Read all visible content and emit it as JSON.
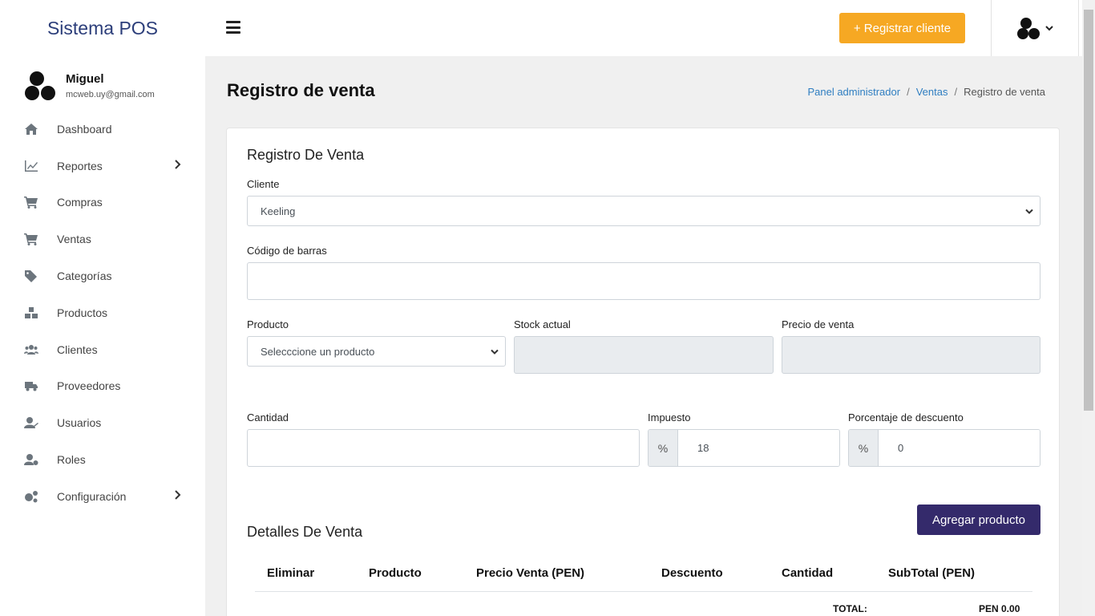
{
  "app": {
    "brand": "Sistema POS"
  },
  "user": {
    "name": "Miguel",
    "email": "mcweb.uy@gmail.com"
  },
  "sidebar": {
    "items": [
      {
        "label": "Dashboard",
        "icon": "home-icon"
      },
      {
        "label": "Reportes",
        "icon": "chart-line-icon",
        "has_submenu": true
      },
      {
        "label": "Compras",
        "icon": "cart-plus-icon"
      },
      {
        "label": "Ventas",
        "icon": "shopping-cart-icon"
      },
      {
        "label": "Categorías",
        "icon": "tags-icon"
      },
      {
        "label": "Productos",
        "icon": "boxes-icon"
      },
      {
        "label": "Clientes",
        "icon": "users-icon"
      },
      {
        "label": "Proveedores",
        "icon": "truck-icon"
      },
      {
        "label": "Usuarios",
        "icon": "user-edit-icon"
      },
      {
        "label": "Roles",
        "icon": "user-cog-icon"
      },
      {
        "label": "Configuración",
        "icon": "cogs-icon",
        "has_submenu": true
      }
    ]
  },
  "topbar": {
    "register_client_label": "+ Registrar cliente"
  },
  "page": {
    "title": "Registro de venta",
    "breadcrumb": [
      "Panel administrador",
      "Ventas",
      "Registro de venta"
    ]
  },
  "form": {
    "card_title": "Registro De Venta",
    "client_label": "Cliente",
    "client_value": "Keeling",
    "barcode_label": "Código de barras",
    "barcode_value": "",
    "product_label": "Producto",
    "product_value": "Selecccione un producto",
    "stock_label": "Stock actual",
    "price_label": "Precio de venta",
    "quantity_label": "Cantidad",
    "tax_label": "Impuesto",
    "tax_addon": "%",
    "tax_value": "18",
    "discount_label": "Porcentaje de descuento",
    "discount_addon": "%",
    "discount_value": "0",
    "add_product_label": "Agregar producto"
  },
  "details": {
    "title": "Detalles De Venta",
    "columns": [
      "Eliminar",
      "Producto",
      "Precio Venta (PEN)",
      "Descuento",
      "Cantidad",
      "SubTotal (PEN)"
    ],
    "total_label": "TOTAL:",
    "total_value": "PEN 0.00"
  },
  "colors": {
    "brand": "#2c3e7a",
    "register_button": "#f6a823",
    "add_button": "#342a6b",
    "link": "#2f7ec1"
  }
}
